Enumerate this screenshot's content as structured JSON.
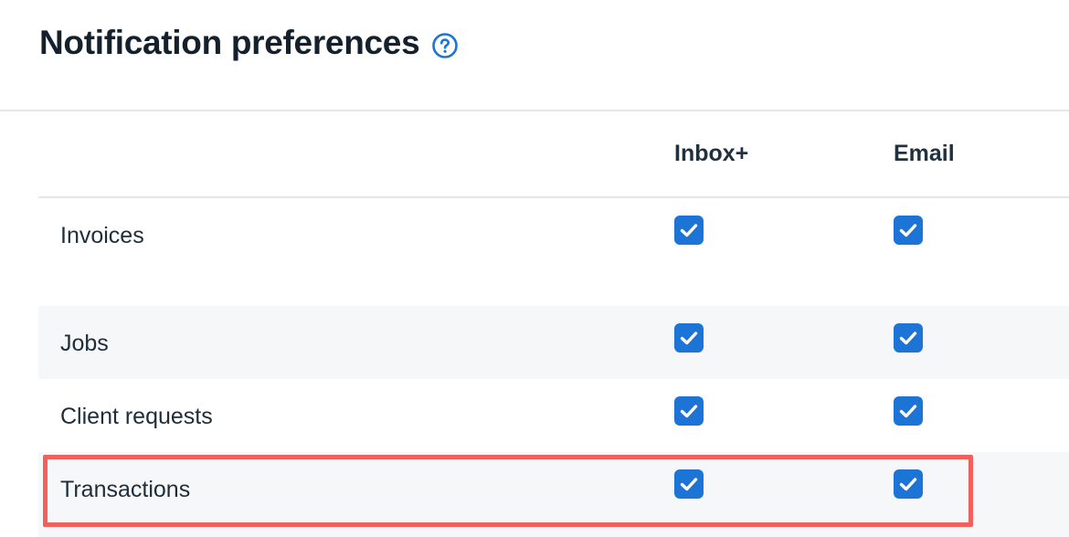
{
  "header": {
    "title": "Notification preferences",
    "help_icon": "question-circle-icon"
  },
  "columns": {
    "inbox": "Inbox+",
    "email": "Email"
  },
  "rows": [
    {
      "label": "Invoices",
      "inbox_checked": true,
      "email_checked": true
    },
    {
      "label": "Jobs",
      "inbox_checked": true,
      "email_checked": true
    },
    {
      "label": "Client requests",
      "inbox_checked": true,
      "email_checked": true
    },
    {
      "label": "Transactions",
      "inbox_checked": true,
      "email_checked": true,
      "highlighted": true
    }
  ],
  "colors": {
    "checkbox": "#1c74d6",
    "highlight": "#f0605d",
    "title": "#14212d"
  }
}
